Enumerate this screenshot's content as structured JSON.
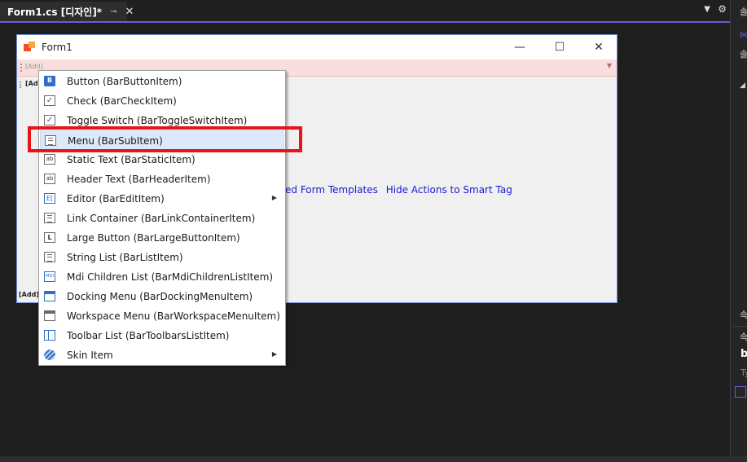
{
  "ide": {
    "tab_title": "Form1.cs [디자인]*",
    "tab_pin_icon": "pin-icon",
    "tab_close_icon": "close-icon",
    "strip_dropdown_icon": "chevron-down-icon",
    "strip_gear_icon": "gear-icon",
    "accent_color": "#6b5bd6"
  },
  "right_panel": {
    "labels": [
      "솔",
      "솔",
      "속",
      "속",
      "b"
    ],
    "input_hint": "Ty"
  },
  "form": {
    "title": "Form1",
    "minimize_icon": "minimize-icon",
    "maximize_icon": "maximize-icon",
    "close_icon": "close-icon",
    "bar1_add": "[Add]",
    "bar2_add": "[Add",
    "status_add": "[Add]",
    "link_templates": "ed Form Templates",
    "link_hide_actions": "Hide Actions to Smart Tag"
  },
  "context_menu": {
    "items": [
      {
        "label": "Button (BarButtonItem)",
        "icon": "button-icon"
      },
      {
        "label": "Check (BarCheckItem)",
        "icon": "check-icon"
      },
      {
        "label": "Toggle Switch (BarToggleSwitchItem)",
        "icon": "toggle-check-icon"
      },
      {
        "label": "Menu (BarSubItem)",
        "icon": "menu-icon"
      },
      {
        "label": "Static Text (BarStaticItem)",
        "icon": "static-text-icon"
      },
      {
        "label": "Header Text (BarHeaderItem)",
        "icon": "header-text-icon"
      },
      {
        "label": "Editor (BarEditItem)",
        "icon": "editor-icon"
      },
      {
        "label": "Link Container (BarLinkContainerItem)",
        "icon": "link-container-icon"
      },
      {
        "label": "Large Button (BarLargeButtonItem)",
        "icon": "large-button-icon"
      },
      {
        "label": "String List (BarListItem)",
        "icon": "string-list-icon"
      },
      {
        "label": "Mdi Children List (BarMdiChildrenListItem)",
        "icon": "mdi-list-icon"
      },
      {
        "label": "Docking Menu (BarDockingMenuItem)",
        "icon": "docking-menu-icon"
      },
      {
        "label": "Workspace Menu (BarWorkspaceMenuItem)",
        "icon": "workspace-menu-icon"
      },
      {
        "label": "Toolbar List (BarToolbarsListItem)",
        "icon": "toolbar-list-icon"
      },
      {
        "label": "Skin Item",
        "icon": "skin-icon"
      }
    ],
    "icon_glyphs": {
      "button": "B",
      "check": "✓",
      "ab": "ab",
      "L": "L",
      "mdi": "MDI",
      "editor": "E[",
      "submenu": "▶"
    },
    "highlight_color": "#e8141a"
  }
}
